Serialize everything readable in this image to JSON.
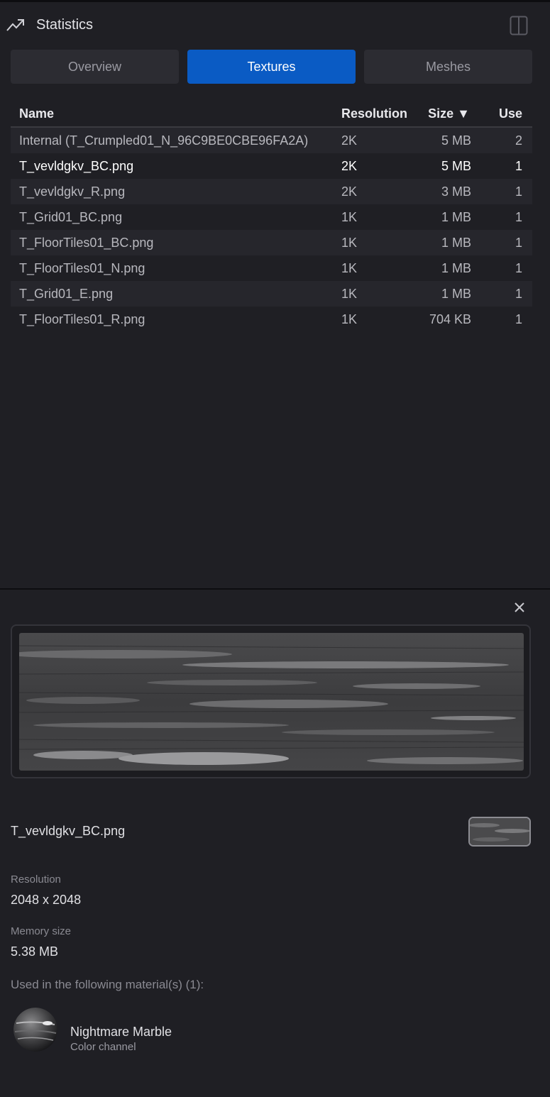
{
  "header": {
    "title": "Statistics"
  },
  "tabs": [
    {
      "label": "Overview",
      "active": false
    },
    {
      "label": "Textures",
      "active": true
    },
    {
      "label": "Meshes",
      "active": false
    }
  ],
  "table": {
    "columns": {
      "name": "Name",
      "resolution": "Resolution",
      "size": "Size ▼",
      "use": "Use"
    },
    "rows": [
      {
        "name": "Internal (T_Crumpled01_N_96C9BE0CBE96FA2A)",
        "resolution": "2K",
        "size": "5 MB",
        "use": "2"
      },
      {
        "name": "T_vevldgkv_BC.png",
        "resolution": "2K",
        "size": "5 MB",
        "use": "1"
      },
      {
        "name": "T_vevldgkv_R.png",
        "resolution": "2K",
        "size": "3 MB",
        "use": "1"
      },
      {
        "name": "T_Grid01_BC.png",
        "resolution": "1K",
        "size": "1 MB",
        "use": "1"
      },
      {
        "name": "T_FloorTiles01_BC.png",
        "resolution": "1K",
        "size": "1 MB",
        "use": "1"
      },
      {
        "name": "T_FloorTiles01_N.png",
        "resolution": "1K",
        "size": "1 MB",
        "use": "1"
      },
      {
        "name": "T_Grid01_E.png",
        "resolution": "1K",
        "size": "1 MB",
        "use": "1"
      },
      {
        "name": "T_FloorTiles01_R.png",
        "resolution": "1K",
        "size": "704 KB",
        "use": "1"
      }
    ]
  },
  "details": {
    "file_name": "T_vevldgkv_BC.png",
    "resolution_label": "Resolution",
    "resolution_value": "2048 x 2048",
    "memory_label": "Memory size",
    "memory_value": "5.38 MB",
    "used_in_label": "Used in the following material(s) (1):",
    "materials": [
      {
        "name": "Nightmare Marble",
        "channel": "Color channel"
      }
    ]
  },
  "colors": {
    "accent": "#0a5bc4",
    "background": "#1f1f24",
    "tab_inactive": "#2c2c32"
  }
}
